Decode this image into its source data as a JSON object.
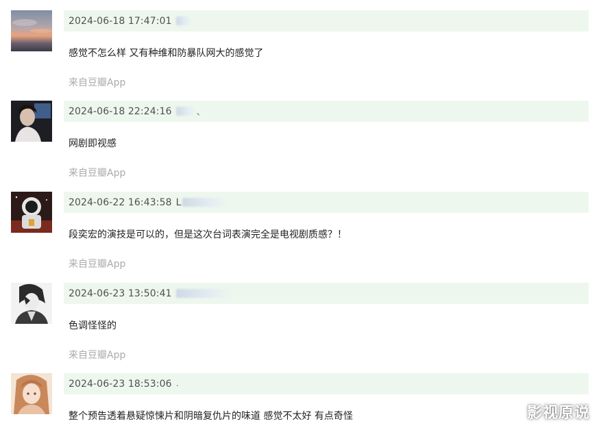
{
  "comments": [
    {
      "time": "2024-06-18 17:47:01",
      "username_visible": "",
      "text": "感觉不怎么样 又有种维和防暴队网大的感觉了",
      "source": "来自豆瓣App"
    },
    {
      "time": "2024-06-18 22:24:16",
      "username_visible": "、",
      "text": "网剧即视感",
      "source": "来自豆瓣App"
    },
    {
      "time": "2024-06-22 16:43:58",
      "username_visible": "L",
      "text": "段奕宏的演技是可以的，但是这次台词表演完全是电视剧质感？！",
      "source": "来自豆瓣App"
    },
    {
      "time": "2024-06-23 13:50:41",
      "username_visible": "",
      "text": "色调怪怪的",
      "source": "来自豆瓣App"
    },
    {
      "time": "2024-06-23 18:53:06",
      "username_visible": ".",
      "text": "整个预告透着悬疑惊悚片和阴暗复仇片的味道 感觉不太好 有点奇怪",
      "source": ""
    }
  ],
  "watermark": "影视原说",
  "colors": {
    "header_bg": "#eef7ee",
    "source_text": "#aaaaaa",
    "body_text": "#222222"
  }
}
